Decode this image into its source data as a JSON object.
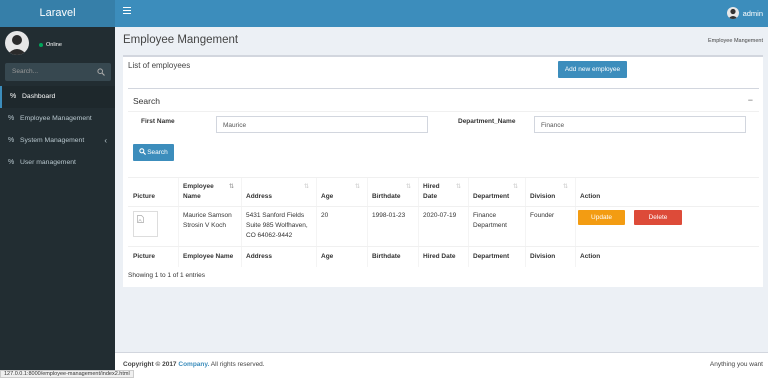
{
  "app": {
    "logo": "Laravel"
  },
  "topbar": {
    "user_name": "admin"
  },
  "sidebar": {
    "status": "Online",
    "search_placeholder": "Search...",
    "items": [
      {
        "label": "Dashboard"
      },
      {
        "label": "Employee Management"
      },
      {
        "label": "System Management"
      },
      {
        "label": "User management"
      }
    ]
  },
  "header": {
    "title": "Employee Mangement",
    "breadcrumb": "Employee Mangement"
  },
  "box": {
    "title": "List of employees",
    "add_button": "Add new employee"
  },
  "search": {
    "title": "Search",
    "collapse": "−",
    "first_name_label": "First Name",
    "first_name_value": "Maurice",
    "department_label": "Department_Name",
    "department_value": "Finance",
    "button": "Search"
  },
  "table": {
    "headers": [
      "Picture",
      "Employee Name",
      "Address",
      "Age",
      "Birthdate",
      "Hired Date",
      "Department",
      "Division",
      "Action"
    ],
    "footer_headers": [
      "Picture",
      "Employee Name",
      "Address",
      "Age",
      "Birthdate",
      "Hired Date",
      "Department",
      "Division",
      "Action"
    ],
    "rows": [
      {
        "name": "Maurice Samson Strosin V Koch",
        "address": "5431 Sanford Fields Suite 985 Wolfhaven, CO 64062-9442",
        "age": "20",
        "birthdate": "1998-01-23",
        "hired": "2020-07-19",
        "department": "Finance Department",
        "division": "Founder",
        "update_label": "Update",
        "delete_label": "Delete"
      }
    ],
    "info": "Showing 1 to 1 of 1 entries"
  },
  "footer": {
    "copyright_prefix": "Copyright © 2017",
    "company": "Company.",
    "rights": "All rights reserved.",
    "version": "Anything you want"
  },
  "statusbar": {
    "url": "127.0.0.1:8000/employee-management/index2.html"
  },
  "colors": {
    "primary": "#3c8dbc",
    "logo_bg": "#367fa9",
    "sidebar_bg": "#222d32",
    "warning": "#f39c12",
    "danger": "#dd4b39",
    "online": "#00a65a"
  },
  "icons": {
    "menu": "hamburger-icon",
    "search": "search-icon",
    "nav": "link-icon",
    "chevron": "chevron-left-icon"
  }
}
